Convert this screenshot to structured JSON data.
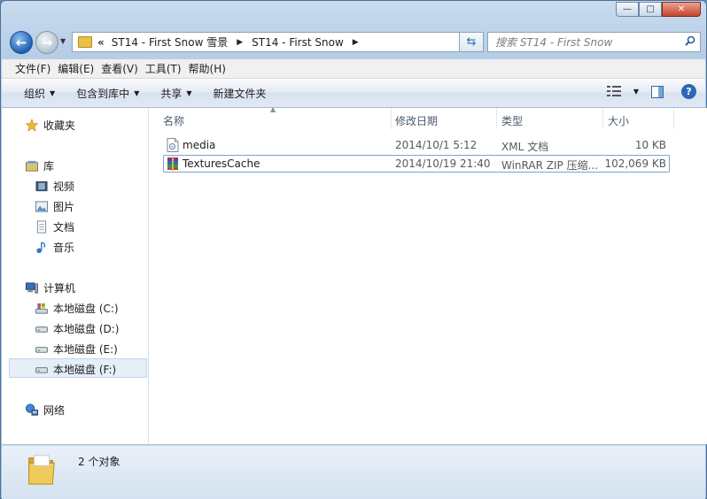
{
  "window": {
    "caption": {
      "min": "—",
      "max": "□",
      "close": "✕"
    }
  },
  "address": {
    "prefix": "«",
    "crumbs": [
      "ST14 - First Snow 雪景",
      "ST14 - First Snow"
    ],
    "refresh_icon": "refresh-icon",
    "search_placeholder": "搜索 ST14 - First Snow"
  },
  "menu": [
    "文件(F)",
    "编辑(E)",
    "查看(V)",
    "工具(T)",
    "帮助(H)"
  ],
  "toolbar": {
    "organize": "组织",
    "include_library": "包含到库中",
    "share": "共享",
    "new_folder": "新建文件夹"
  },
  "nav": {
    "favorites": "收藏夹",
    "libraries": "库",
    "lib_items": [
      "视频",
      "图片",
      "文档",
      "音乐"
    ],
    "computer": "计算机",
    "drives": [
      "本地磁盘 (C:)",
      "本地磁盘 (D:)",
      "本地磁盘 (E:)",
      "本地磁盘 (F:)"
    ],
    "network": "网络"
  },
  "columns": {
    "name": "名称",
    "date": "修改日期",
    "type": "类型",
    "size": "大小"
  },
  "files": [
    {
      "name": "media",
      "date": "2014/10/1 5:12",
      "type": "XML 文档",
      "size": "10 KB"
    },
    {
      "name": "TexturesCache",
      "date": "2014/10/19 21:40",
      "type": "WinRAR ZIP 压缩...",
      "size": "102,069 KB"
    }
  ],
  "status": {
    "text": "2 个对象"
  },
  "colors": {
    "accent": "#2d68b6",
    "selection": "#e5eef9"
  }
}
